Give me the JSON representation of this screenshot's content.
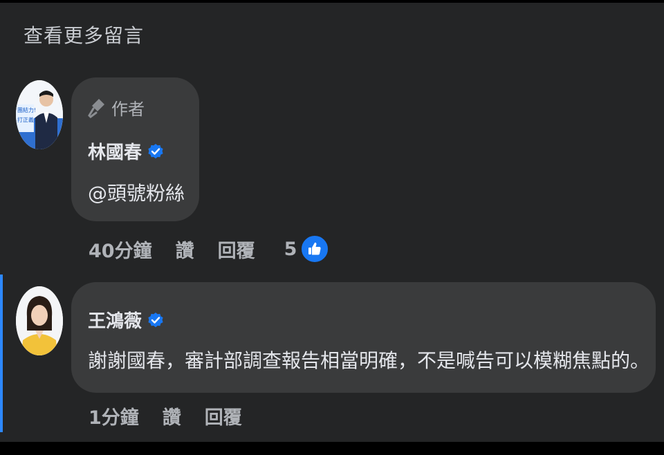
{
  "view_more_label": "查看更多留言",
  "comments": [
    {
      "author_tag": "作者",
      "name": "林國春",
      "text": "@頭號粉絲",
      "time": "40分鐘",
      "like_label": "讚",
      "reply_label": "回覆",
      "reaction_count": "5",
      "avatar_banner_lines": [
        "團結力!",
        "打正義!"
      ]
    },
    {
      "name": "王鴻薇",
      "text": "謝謝國春，審計部調查報告相當明確，不是喊告可以模糊焦點的。",
      "time": "1分鐘",
      "like_label": "讚",
      "reply_label": "回覆"
    }
  ],
  "colors": {
    "panel": "#242526",
    "bubble": "#3a3b3c",
    "accent": "#2d88ff",
    "verified": "#1877f2"
  }
}
